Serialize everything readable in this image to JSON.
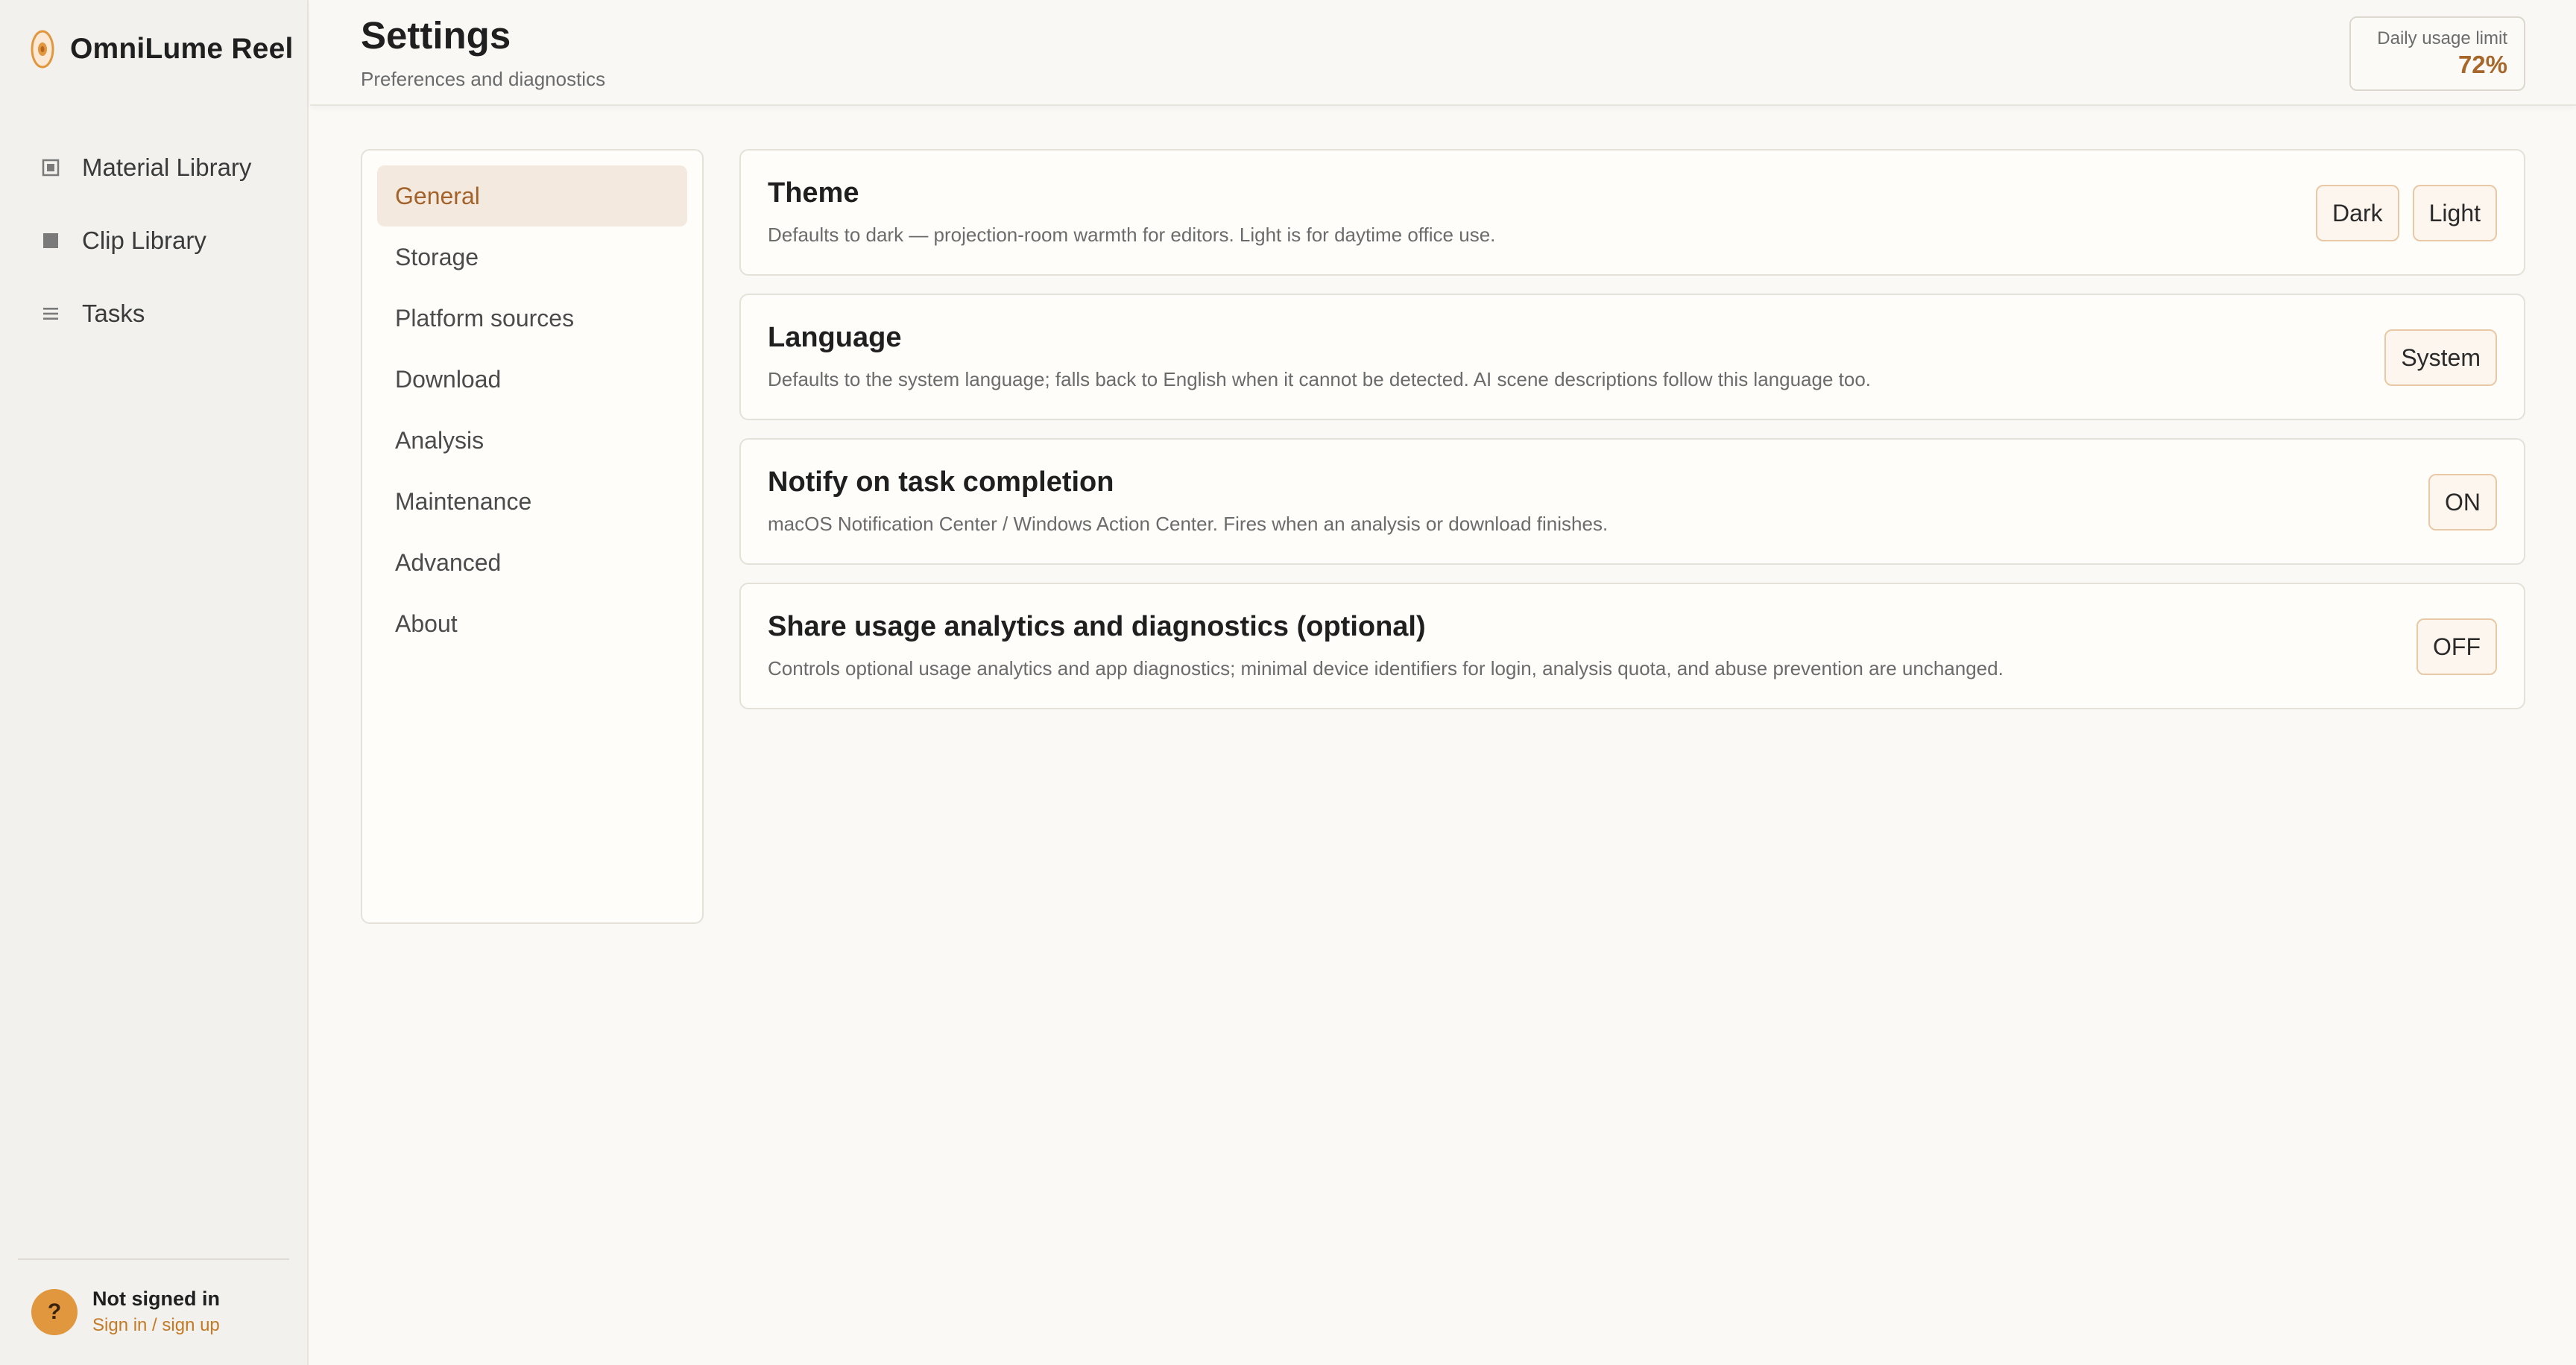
{
  "app": {
    "name": "OmniLume Reel",
    "logo_icon": "film-reel-logo-icon",
    "accent": "#e0973e"
  },
  "sidebar": {
    "items": [
      {
        "label": "Material Library",
        "icon": "material-library-icon"
      },
      {
        "label": "Clip Library",
        "icon": "clip-library-icon"
      },
      {
        "label": "Tasks",
        "icon": "tasks-list-icon"
      }
    ],
    "account": {
      "avatar_text": "?",
      "status": "Not signed in",
      "link": "Sign in / sign up"
    }
  },
  "header": {
    "title": "Settings",
    "subtitle": "Preferences and diagnostics",
    "usage": {
      "label": "Daily usage limit",
      "value": "72%"
    }
  },
  "settings_nav": {
    "active_index": 0,
    "items": [
      "General",
      "Storage",
      "Platform sources",
      "Download",
      "Analysis",
      "Maintenance",
      "Advanced",
      "About"
    ]
  },
  "general": {
    "theme": {
      "title": "Theme",
      "description": "Defaults to dark — projection-room warmth for editors. Light is for daytime office use.",
      "options": [
        "Dark",
        "Light"
      ]
    },
    "language": {
      "title": "Language",
      "description": "Defaults to the system language; falls back to English when it cannot be detected. AI scene descriptions follow this language too.",
      "value": "System"
    },
    "notify": {
      "title": "Notify on task completion",
      "description": "macOS Notification Center / Windows Action Center. Fires when an analysis or download finishes.",
      "value": "ON"
    },
    "analytics": {
      "title": "Share usage analytics and diagnostics (optional)",
      "description": "Controls optional usage analytics and app diagnostics; minimal device identifiers for login, analysis quota, and abuse prevention are unchanged.",
      "value": "OFF"
    }
  },
  "colors": {
    "accent_text": "#a3622a",
    "active_nav_bg": "#f3e9df",
    "button_border": "#e9c9a5",
    "button_bg": "#fdf6ee"
  }
}
